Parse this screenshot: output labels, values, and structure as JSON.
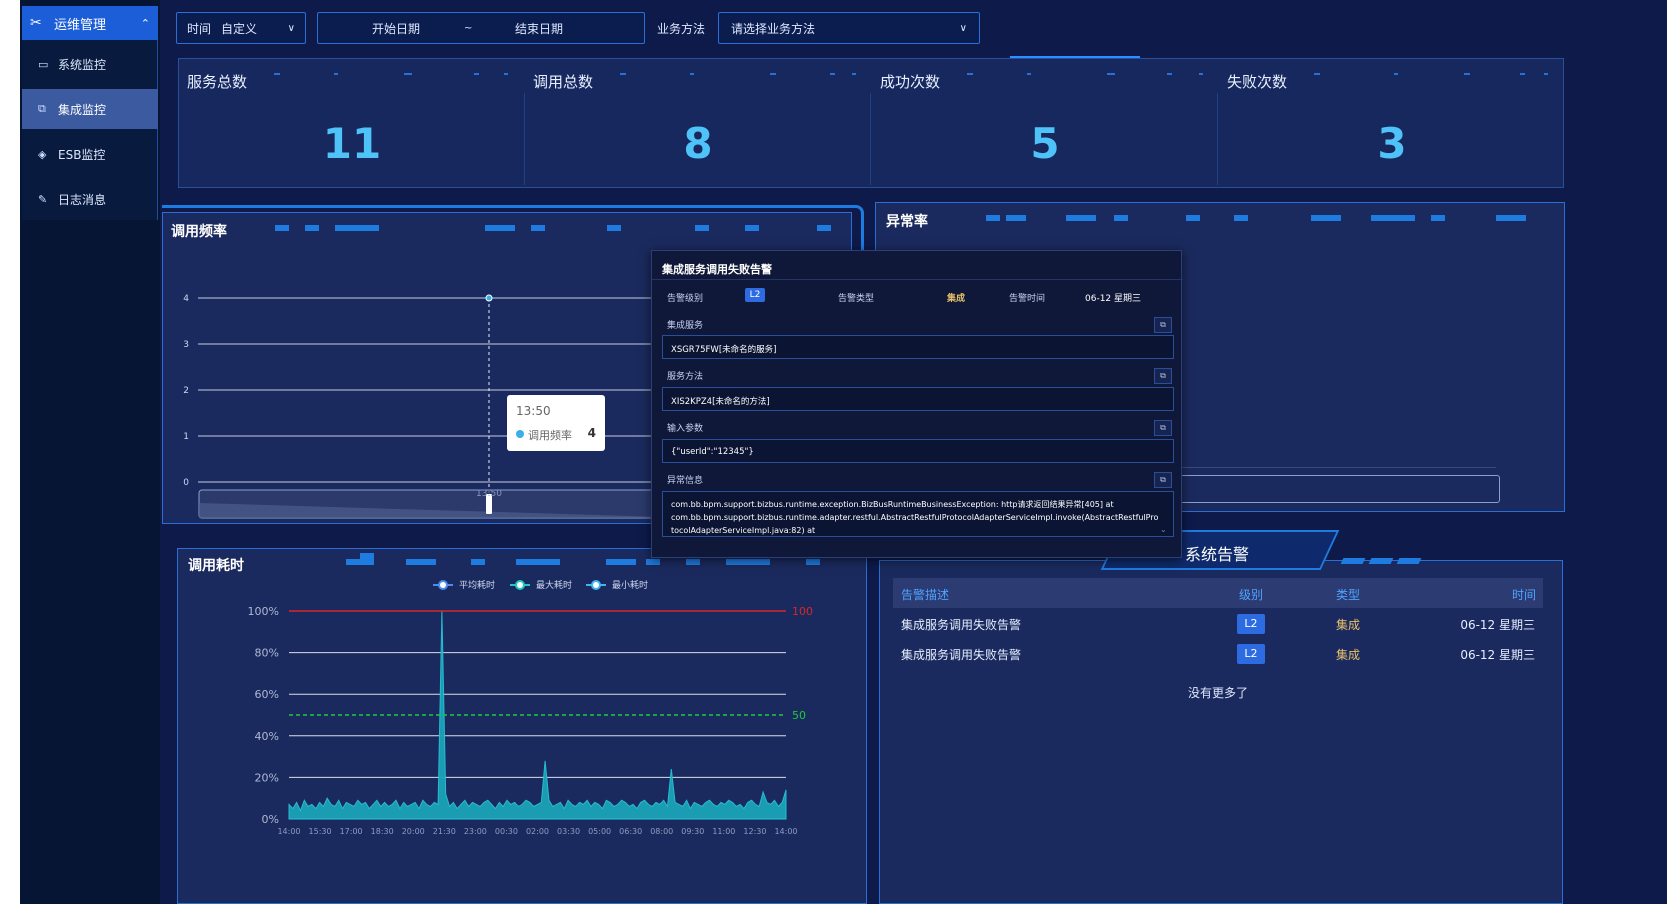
{
  "sidebar": {
    "header": "运维管理",
    "items": [
      {
        "label": "系统监控",
        "icon": "monitor-icon",
        "active": false
      },
      {
        "label": "集成监控",
        "icon": "integration-icon",
        "active": true
      },
      {
        "label": "ESB监控",
        "icon": "esb-diamond-icon",
        "active": false
      },
      {
        "label": "日志消息",
        "icon": "log-icon",
        "active": false
      }
    ]
  },
  "filters": {
    "time_label": "时间",
    "time_value": "自定义",
    "start_date": "开始日期",
    "date_sep": "~",
    "end_date": "结束日期",
    "method_label": "业务方法",
    "method_placeholder": "请选择业务方法"
  },
  "stats": [
    {
      "title": "服务总数",
      "value": "11"
    },
    {
      "title": "调用总数",
      "value": "8"
    },
    {
      "title": "成功次数",
      "value": "5"
    },
    {
      "title": "失败次数",
      "value": "3"
    }
  ],
  "panels": {
    "frequency_title": "调用频率",
    "error_rate_title": "异常率",
    "duration_title": "调用耗时",
    "alarm_title": "系统告警"
  },
  "frequency_tooltip": {
    "time": "13:50",
    "series": "调用频率",
    "value": "4"
  },
  "alarm_dialog": {
    "title": "集成服务调用失败告警",
    "level_label": "告警级别",
    "level_value": "L2",
    "type_label": "告警类型",
    "type_value": "集成",
    "time_label": "告警时间",
    "time_value": "06-12 星期三",
    "service_label": "集成服务",
    "service_value": "XSGR75FW[未命名的服务]",
    "method_label": "服务方法",
    "method_value": "XIS2KPZ4[未命名的方法]",
    "input_label": "输入参数",
    "input_value": "{\"userId\":\"12345\"}",
    "exception_label": "异常信息",
    "exception_lines": [
      "com.bb.bpm.support.bizbus.runtime.exception.BizBusRuntimeBusinessException: http请求返回结果异常[405] at",
      "com.bb.bpm.support.bizbus.runtime.adapter.restful.AbstractRestfulProtocolAdapterServiceImpl.invoke(AbstractRestfulPro",
      "tocolAdapterServiceImpl.java:82) at"
    ]
  },
  "alarm_table": {
    "headers": [
      "告警描述",
      "级别",
      "类型",
      "时间"
    ],
    "rows": [
      {
        "desc": "集成服务调用失败告警",
        "level": "L2",
        "type": "集成",
        "time": "06-12 星期三"
      },
      {
        "desc": "集成服务调用失败告警",
        "level": "L2",
        "type": "集成",
        "time": "06-12 星期三"
      }
    ],
    "footer": "没有更多了"
  },
  "chart_data": [
    {
      "type": "line",
      "title": "调用频率",
      "yticks": [
        "0",
        "1",
        "2",
        "3",
        "4"
      ],
      "ylim": [
        0,
        4
      ],
      "points": [
        {
          "x": "13:50",
          "y": 4
        }
      ],
      "xtick": "13:50",
      "grid": true
    },
    {
      "type": "area",
      "title": "调用耗时",
      "legend": [
        "平均耗时",
        "最大耗时",
        "最小耗时"
      ],
      "legend_placement": "top",
      "yticks": [
        "0%",
        "20%",
        "40%",
        "60%",
        "80%",
        "100%"
      ],
      "ylim": [
        0,
        100
      ],
      "xticks": [
        "14:00",
        "15:30",
        "17:00",
        "18:30",
        "20:00",
        "21:30",
        "23:00",
        "00:30",
        "02:00",
        "03:30",
        "05:00",
        "06:30",
        "08:00",
        "09:30",
        "11:00",
        "12:30",
        "14:00"
      ],
      "markline_max": {
        "value": 100,
        "label": "100"
      },
      "markline_avg": {
        "value": 50,
        "label": "50"
      },
      "values": [
        7,
        5,
        8,
        4,
        9,
        6,
        7,
        5,
        8,
        6,
        10,
        7,
        6,
        9,
        5,
        8,
        7,
        6,
        9,
        7,
        8,
        5,
        7,
        9,
        6,
        8,
        6,
        7,
        9,
        5,
        8,
        6,
        7,
        8,
        5,
        9,
        7,
        6,
        8,
        7,
        100,
        12,
        6,
        8,
        5,
        7,
        9,
        6,
        8,
        7,
        6,
        8,
        9,
        7,
        5,
        8,
        6,
        9,
        7,
        8,
        6,
        7,
        9,
        8,
        6,
        7,
        8,
        28,
        9,
        6,
        7,
        8,
        5,
        9,
        7,
        6,
        8,
        7,
        9,
        6,
        8,
        7,
        5,
        9,
        8,
        6,
        7,
        9,
        8,
        6,
        7,
        5,
        8,
        9,
        7,
        6,
        8,
        7,
        9,
        6,
        24,
        8,
        7,
        6,
        9,
        5,
        8,
        7,
        6,
        8,
        9,
        7,
        6,
        8,
        7,
        9,
        8,
        6,
        7,
        5,
        8,
        9,
        7,
        6,
        13,
        8,
        7,
        9,
        6,
        8,
        14
      ]
    }
  ],
  "colors": {
    "background": "#0d1a4a",
    "accent": "#1e7be0",
    "stat_value": "#4fc3f7",
    "area_fill": "#1aa3b8",
    "max_line": "#d6262a",
    "avg_line": "#1ec93c"
  }
}
